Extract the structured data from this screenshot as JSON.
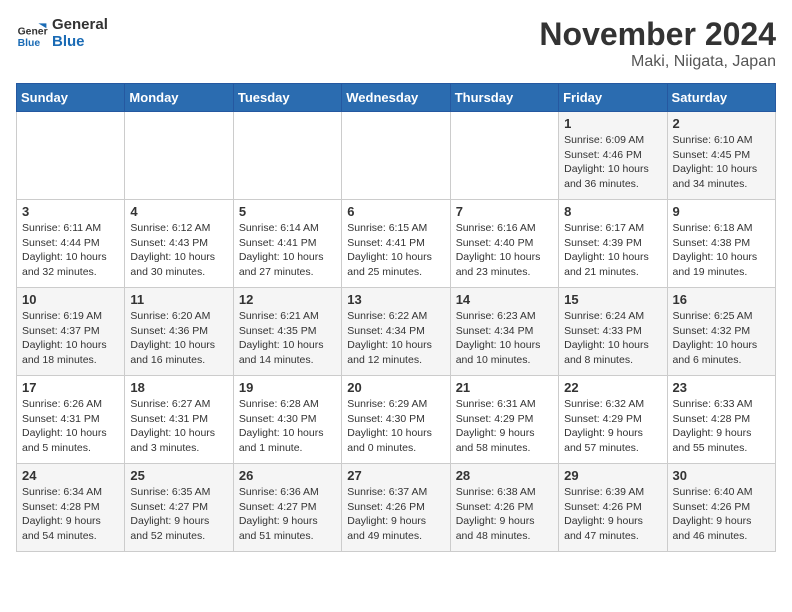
{
  "header": {
    "logo_line1": "General",
    "logo_line2": "Blue",
    "month": "November 2024",
    "location": "Maki, Niigata, Japan"
  },
  "weekdays": [
    "Sunday",
    "Monday",
    "Tuesday",
    "Wednesday",
    "Thursday",
    "Friday",
    "Saturday"
  ],
  "weeks": [
    [
      {
        "day": "",
        "info": ""
      },
      {
        "day": "",
        "info": ""
      },
      {
        "day": "",
        "info": ""
      },
      {
        "day": "",
        "info": ""
      },
      {
        "day": "",
        "info": ""
      },
      {
        "day": "1",
        "info": "Sunrise: 6:09 AM\nSunset: 4:46 PM\nDaylight: 10 hours\nand 36 minutes."
      },
      {
        "day": "2",
        "info": "Sunrise: 6:10 AM\nSunset: 4:45 PM\nDaylight: 10 hours\nand 34 minutes."
      }
    ],
    [
      {
        "day": "3",
        "info": "Sunrise: 6:11 AM\nSunset: 4:44 PM\nDaylight: 10 hours\nand 32 minutes."
      },
      {
        "day": "4",
        "info": "Sunrise: 6:12 AM\nSunset: 4:43 PM\nDaylight: 10 hours\nand 30 minutes."
      },
      {
        "day": "5",
        "info": "Sunrise: 6:14 AM\nSunset: 4:41 PM\nDaylight: 10 hours\nand 27 minutes."
      },
      {
        "day": "6",
        "info": "Sunrise: 6:15 AM\nSunset: 4:41 PM\nDaylight: 10 hours\nand 25 minutes."
      },
      {
        "day": "7",
        "info": "Sunrise: 6:16 AM\nSunset: 4:40 PM\nDaylight: 10 hours\nand 23 minutes."
      },
      {
        "day": "8",
        "info": "Sunrise: 6:17 AM\nSunset: 4:39 PM\nDaylight: 10 hours\nand 21 minutes."
      },
      {
        "day": "9",
        "info": "Sunrise: 6:18 AM\nSunset: 4:38 PM\nDaylight: 10 hours\nand 19 minutes."
      }
    ],
    [
      {
        "day": "10",
        "info": "Sunrise: 6:19 AM\nSunset: 4:37 PM\nDaylight: 10 hours\nand 18 minutes."
      },
      {
        "day": "11",
        "info": "Sunrise: 6:20 AM\nSunset: 4:36 PM\nDaylight: 10 hours\nand 16 minutes."
      },
      {
        "day": "12",
        "info": "Sunrise: 6:21 AM\nSunset: 4:35 PM\nDaylight: 10 hours\nand 14 minutes."
      },
      {
        "day": "13",
        "info": "Sunrise: 6:22 AM\nSunset: 4:34 PM\nDaylight: 10 hours\nand 12 minutes."
      },
      {
        "day": "14",
        "info": "Sunrise: 6:23 AM\nSunset: 4:34 PM\nDaylight: 10 hours\nand 10 minutes."
      },
      {
        "day": "15",
        "info": "Sunrise: 6:24 AM\nSunset: 4:33 PM\nDaylight: 10 hours\nand 8 minutes."
      },
      {
        "day": "16",
        "info": "Sunrise: 6:25 AM\nSunset: 4:32 PM\nDaylight: 10 hours\nand 6 minutes."
      }
    ],
    [
      {
        "day": "17",
        "info": "Sunrise: 6:26 AM\nSunset: 4:31 PM\nDaylight: 10 hours\nand 5 minutes."
      },
      {
        "day": "18",
        "info": "Sunrise: 6:27 AM\nSunset: 4:31 PM\nDaylight: 10 hours\nand 3 minutes."
      },
      {
        "day": "19",
        "info": "Sunrise: 6:28 AM\nSunset: 4:30 PM\nDaylight: 10 hours\nand 1 minute."
      },
      {
        "day": "20",
        "info": "Sunrise: 6:29 AM\nSunset: 4:30 PM\nDaylight: 10 hours\nand 0 minutes."
      },
      {
        "day": "21",
        "info": "Sunrise: 6:31 AM\nSunset: 4:29 PM\nDaylight: 9 hours\nand 58 minutes."
      },
      {
        "day": "22",
        "info": "Sunrise: 6:32 AM\nSunset: 4:29 PM\nDaylight: 9 hours\nand 57 minutes."
      },
      {
        "day": "23",
        "info": "Sunrise: 6:33 AM\nSunset: 4:28 PM\nDaylight: 9 hours\nand 55 minutes."
      }
    ],
    [
      {
        "day": "24",
        "info": "Sunrise: 6:34 AM\nSunset: 4:28 PM\nDaylight: 9 hours\nand 54 minutes."
      },
      {
        "day": "25",
        "info": "Sunrise: 6:35 AM\nSunset: 4:27 PM\nDaylight: 9 hours\nand 52 minutes."
      },
      {
        "day": "26",
        "info": "Sunrise: 6:36 AM\nSunset: 4:27 PM\nDaylight: 9 hours\nand 51 minutes."
      },
      {
        "day": "27",
        "info": "Sunrise: 6:37 AM\nSunset: 4:26 PM\nDaylight: 9 hours\nand 49 minutes."
      },
      {
        "day": "28",
        "info": "Sunrise: 6:38 AM\nSunset: 4:26 PM\nDaylight: 9 hours\nand 48 minutes."
      },
      {
        "day": "29",
        "info": "Sunrise: 6:39 AM\nSunset: 4:26 PM\nDaylight: 9 hours\nand 47 minutes."
      },
      {
        "day": "30",
        "info": "Sunrise: 6:40 AM\nSunset: 4:26 PM\nDaylight: 9 hours\nand 46 minutes."
      }
    ]
  ]
}
